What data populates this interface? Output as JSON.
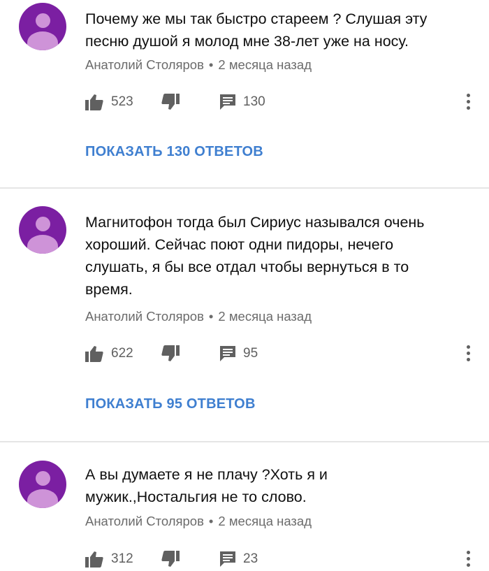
{
  "comments": [
    {
      "text": "Почему же мы так быстро стареем ? Слушая эту\nпесню душой я молод мне 38-лет уже на носу.",
      "author": "Анатолий Столяров",
      "separator": "•",
      "time": "2 месяца назад",
      "likes": "523",
      "reply_count": "130",
      "show_replies": "ПОКАЗАТЬ 130 ОТВЕТОВ"
    },
    {
      "text": "Магнитофон тогда был Сириус назывался очень\nхороший. Сейчас поют одни пидоры, нечего\nслушать, я бы все отдал чтобы вернуться в то\nвремя.",
      "author": "Анатолий Столяров",
      "separator": "•",
      "time": "2 месяца назад",
      "likes": "622",
      "reply_count": "95",
      "show_replies": "ПОКАЗАТЬ 95 ОТВЕТОВ"
    },
    {
      "text": "А вы думаете я не плачу ?Хоть я и\nмужик.,Ностальгия не то слово.",
      "author": "Анатолий Столяров",
      "separator": "•",
      "time": "2 месяца назад",
      "likes": "312",
      "reply_count": "23"
    }
  ],
  "icons": {
    "like": "thumbs-up-icon",
    "dislike": "thumbs-down-icon",
    "reply": "comment-icon",
    "more": "more-vert-icon"
  },
  "colors": {
    "avatar": "#7b1fa2",
    "avatar_figure": "#ce93d8",
    "link": "#3f7fd0",
    "meta": "#6b6b6b"
  }
}
